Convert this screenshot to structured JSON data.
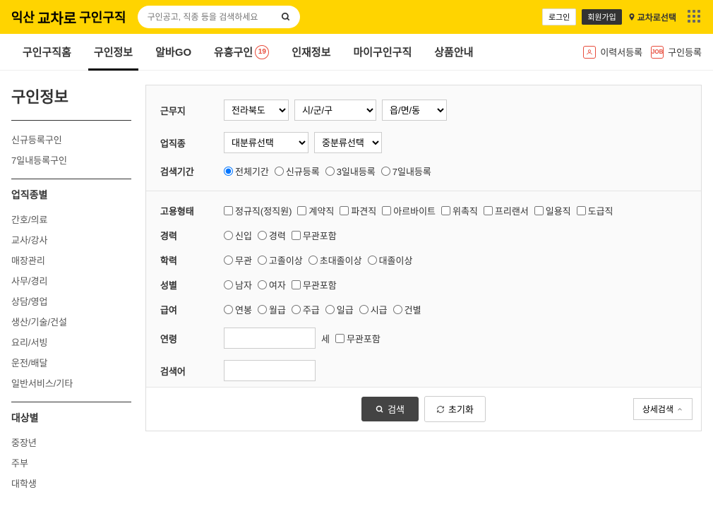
{
  "header": {
    "logo_prefix": "익산",
    "logo_brand": "교차로",
    "logo_suffix": "구인구직",
    "search_placeholder": "구인공고, 직종 등을 검색하세요",
    "login": "로그인",
    "signup": "회원가입",
    "location_select": "교차로선택"
  },
  "nav": {
    "items": [
      "구인구직홈",
      "구인정보",
      "알바GO",
      "유흥구인",
      "인재정보",
      "마이구인구직",
      "상품안내"
    ],
    "badge": "19",
    "resume_reg": "이력서등록",
    "job_reg": "구인등록"
  },
  "sidebar": {
    "title": "구인정보",
    "quick": [
      "신규등록구인",
      "7일내등록구인"
    ],
    "cat_title": "업직종별",
    "cats": [
      "간호/의료",
      "교사/강사",
      "매장관리",
      "사무/경리",
      "상담/영업",
      "생산/기술/건설",
      "요리/서빙",
      "운전/배달",
      "일반서비스/기타"
    ],
    "target_title": "대상별",
    "targets": [
      "중장년",
      "주부",
      "대학생"
    ]
  },
  "filters": {
    "location_label": "근무지",
    "province": "전라북도",
    "city": "시/군/구",
    "district": "읍/면/동",
    "category_label": "업직종",
    "cat_major": "대분류선택",
    "cat_minor": "중분류선택",
    "period_label": "검색기간",
    "periods": [
      "전체기간",
      "신규등록",
      "3일내등록",
      "7일내등록"
    ],
    "emp_label": "고용형태",
    "emps": [
      "정규직(정직원)",
      "계약직",
      "파견직",
      "아르바이트",
      "위촉직",
      "프리랜서",
      "일용직",
      "도급직"
    ],
    "career_label": "경력",
    "careers": [
      "신입",
      "경력",
      "무관포함"
    ],
    "edu_label": "학력",
    "edus": [
      "무관",
      "고졸이상",
      "초대졸이상",
      "대졸이상"
    ],
    "gender_label": "성별",
    "genders": [
      "남자",
      "여자",
      "무관포함"
    ],
    "salary_label": "급여",
    "salaries": [
      "연봉",
      "월급",
      "주급",
      "일급",
      "시급",
      "건별"
    ],
    "age_label": "연령",
    "age_unit": "세",
    "age_any": "무관포함",
    "keyword_label": "검색어"
  },
  "actions": {
    "search": "검색",
    "reset": "초기화",
    "detail": "상세검색"
  }
}
